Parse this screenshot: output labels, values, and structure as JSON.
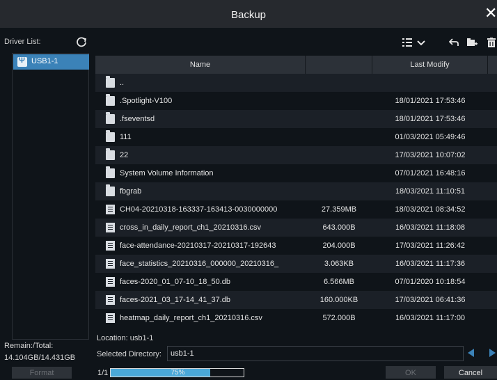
{
  "window": {
    "title": "Backup"
  },
  "driver_list": {
    "label": "Driver List:",
    "items": [
      {
        "label": "USB1-1",
        "icon": "usb-icon",
        "selected": true
      }
    ]
  },
  "storage": {
    "remain_label": "Remain:/Total:",
    "remain_value": "14.104GB/14.431GB"
  },
  "buttons": {
    "format": "Format",
    "ok": "OK",
    "cancel": "Cancel"
  },
  "toolbar": {
    "icons": [
      "list-view-icon",
      "chevron-down-icon",
      "back-arrow-icon",
      "new-folder-icon",
      "delete-icon"
    ]
  },
  "table": {
    "headers": {
      "name": "Name",
      "size": "",
      "modified": "Last Modify"
    },
    "rows": [
      {
        "type": "folder",
        "name": "..",
        "size": "",
        "date": ""
      },
      {
        "type": "folder",
        "name": ".Spotlight-V100",
        "size": "",
        "date": "18/01/2021 17:53:46"
      },
      {
        "type": "folder",
        "name": ".fseventsd",
        "size": "",
        "date": "18/01/2021 17:53:46"
      },
      {
        "type": "folder",
        "name": "111",
        "size": "",
        "date": "01/03/2021 05:49:46"
      },
      {
        "type": "folder",
        "name": "22",
        "size": "",
        "date": "17/03/2021 10:07:02"
      },
      {
        "type": "folder",
        "name": "System Volume Information",
        "size": "",
        "date": "07/01/2021 16:48:16"
      },
      {
        "type": "folder",
        "name": "fbgrab",
        "size": "",
        "date": "18/03/2021 11:10:51"
      },
      {
        "type": "file",
        "name": "CH04-20210318-163337-163413-0030000000",
        "size": "27.359MB",
        "date": "18/03/2021 08:34:52"
      },
      {
        "type": "file",
        "name": "cross_in_daily_report_ch1_20210316.csv",
        "size": "643.000B",
        "date": "16/03/2021 11:18:08"
      },
      {
        "type": "file",
        "name": "face-attendance-20210317-20210317-192643",
        "size": "204.000B",
        "date": "17/03/2021 11:26:42"
      },
      {
        "type": "file",
        "name": "face_statistics_20210316_000000_20210316_",
        "size": "3.063KB",
        "date": "16/03/2021 11:17:36"
      },
      {
        "type": "file",
        "name": "faces-2020_01_07-10_18_50.db",
        "size": "6.566MB",
        "date": "07/01/2020 10:18:54"
      },
      {
        "type": "file",
        "name": "faces-2021_03_17-14_41_37.db",
        "size": "160.000KB",
        "date": "17/03/2021 06:41:36"
      },
      {
        "type": "file",
        "name": "heatmap_daily_report_ch1_20210316.csv",
        "size": "572.000B",
        "date": "16/03/2021 11:17:00"
      }
    ]
  },
  "location": {
    "label": "Location:",
    "value": "usb1-1",
    "selected_dir_label": "Selected Directory:",
    "selected_dir_value": "usb1-1"
  },
  "progress": {
    "page": "1/1",
    "percent_text": "75%",
    "fraction": 0.75
  },
  "colors": {
    "accent": "#3b82b8",
    "progress": "#4aa8d8",
    "background": "#0f1419",
    "row_alt": "#1b2027"
  }
}
